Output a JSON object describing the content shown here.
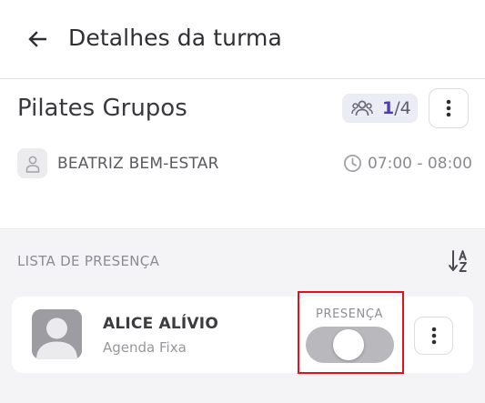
{
  "header": {
    "back_icon": "arrow-left-icon",
    "title": "Detalhes da turma"
  },
  "class_info": {
    "name": "Pilates Grupos",
    "occupancy": {
      "icon": "group-icon",
      "current": "1",
      "separator": "/",
      "capacity": "4"
    },
    "more_icon": "more-vertical-icon",
    "instructor": {
      "avatar_icon": "user-icon",
      "name": "BEATRIZ BEM-ESTAR"
    },
    "time": {
      "icon": "clock-icon",
      "range": "07:00 - 08:00"
    }
  },
  "attendance": {
    "title": "LISTA DE PRESENÇA",
    "sort_icon": "sort-alpha-az-icon",
    "students": [
      {
        "name": "ALICE ALÍVIO",
        "subtitle": "Agenda Fixa",
        "presence_label": "PRESENÇA",
        "present": false
      }
    ]
  },
  "colors": {
    "accent": "#4a3fa8",
    "badge_bg": "#ececf7",
    "section_bg": "#f4f4f7",
    "toggle_off": "#b9b9bd",
    "highlight": "#e0121b"
  }
}
